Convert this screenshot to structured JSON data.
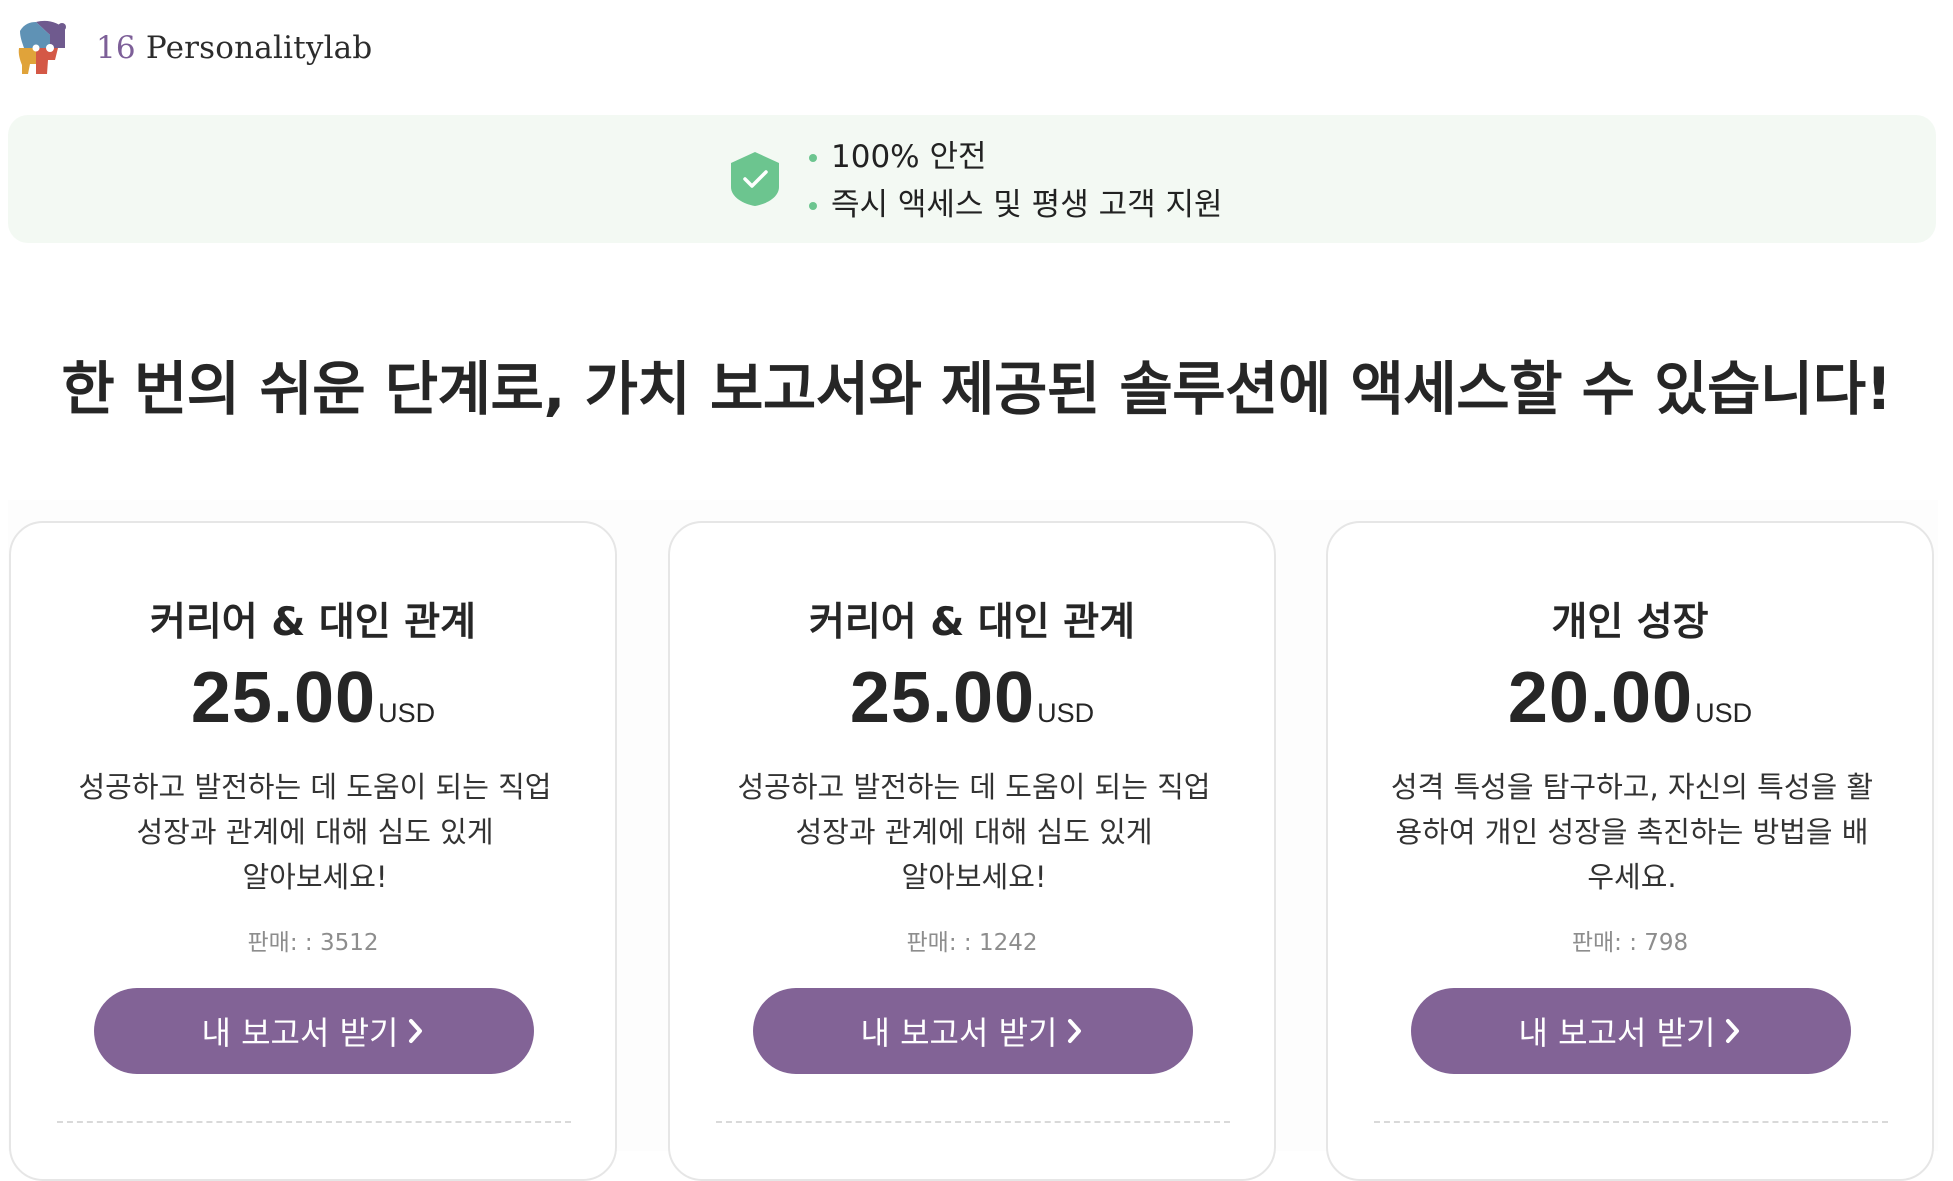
{
  "header": {
    "brand_number": "16",
    "brand_name": "Personalitylab",
    "logo_icon": "puzzle-head-logo-icon"
  },
  "trust": {
    "icon": "shield-check-icon",
    "accent_color": "#6cc58f",
    "items": [
      "100% 안전",
      "즉시 액세스 및 평생 고객 지원"
    ]
  },
  "headline": "한 번의 쉬운 단계로, 가치 보고서와 제공된 솔루션에 액세스할 수 있습니다!",
  "plans": [
    {
      "title": "커리어 & 대인 관계",
      "price": "25.00",
      "currency": "USD",
      "description": "성공하고 발전하는 데 도움이 되는 직업 성장과 관계에 대해 심도 있게 알아보세요!",
      "sales": "판매: : 3512",
      "button_label": "내 보고서 받기"
    },
    {
      "title": "커리어 & 대인 관계",
      "price": "25.00",
      "currency": "USD",
      "description": "성공하고 발전하는 데 도움이 되는 직업 성장과 관계에 대해 심도 있게 알아보세요!",
      "sales": "판매: : 1242",
      "button_label": "내 보고서 받기"
    },
    {
      "title": "개인 성장",
      "price": "20.00",
      "currency": "USD",
      "description": "성격 특성을 탐구하고, 자신의 특성을 활용하여 개인 성장을 촉진하는 방법을 배우세요.",
      "sales": "판매: : 798",
      "button_label": "내 보고서 받기"
    }
  ],
  "colors": {
    "brand_purple": "#826396",
    "banner_background": "#f3f9f3",
    "shield_green": "#6cc58f"
  }
}
